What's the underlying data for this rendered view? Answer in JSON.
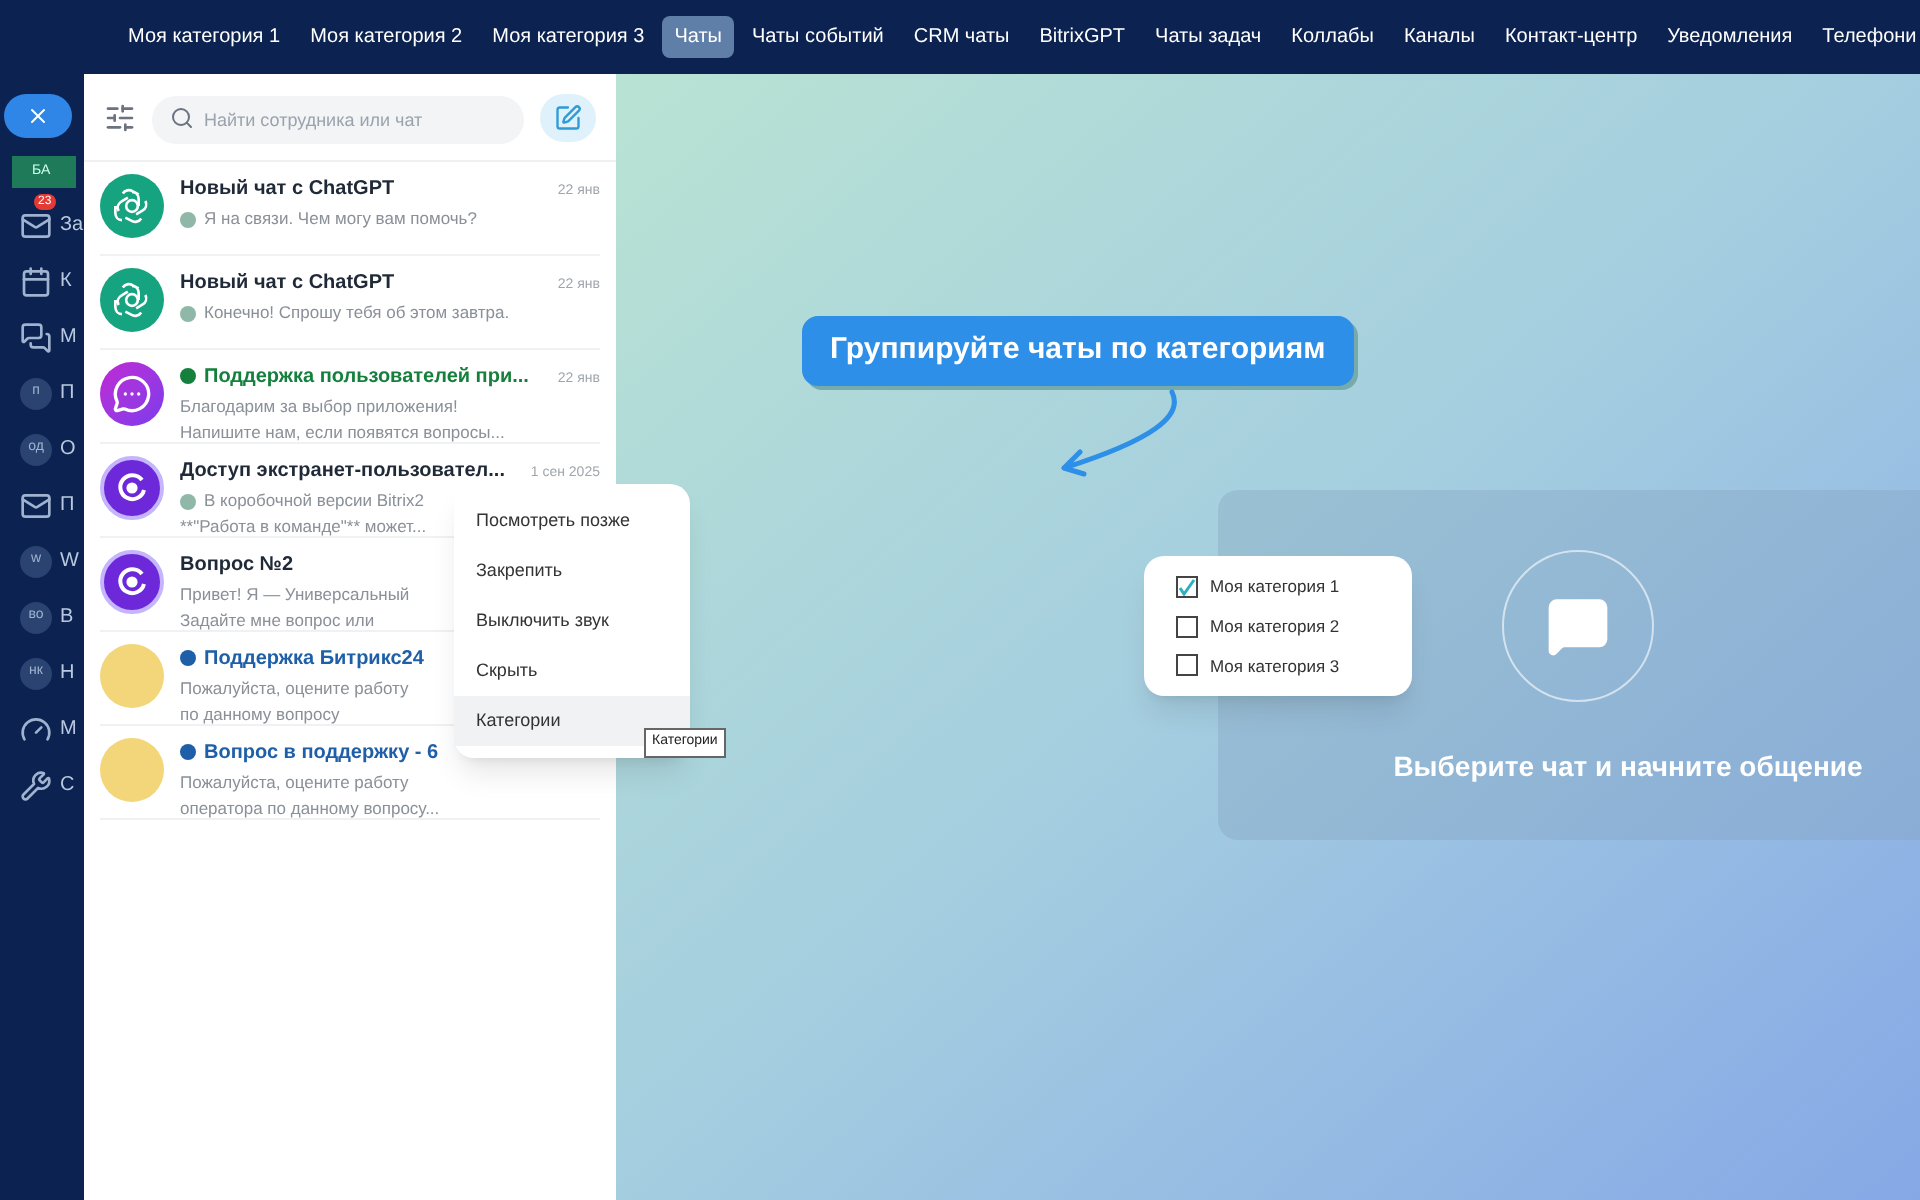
{
  "top_nav": [
    {
      "label": "Моя категория 1",
      "selected": false
    },
    {
      "label": "Моя категория 2",
      "selected": false
    },
    {
      "label": "Моя категория 3",
      "selected": false
    },
    {
      "label": "Чаты",
      "selected": true
    },
    {
      "label": "Чаты событий",
      "selected": false
    },
    {
      "label": "CRM чаты",
      "selected": false
    },
    {
      "label": "BitrixGPT",
      "selected": false
    },
    {
      "label": "Чаты задач",
      "selected": false
    },
    {
      "label": "Коллабы",
      "selected": false
    },
    {
      "label": "Каналы",
      "selected": false
    },
    {
      "label": "Контакт-центр",
      "selected": false
    },
    {
      "label": "Уведомления",
      "selected": false
    },
    {
      "label": "Телефони"
    }
  ],
  "sidebar": {
    "button_label": "БА",
    "items": [
      {
        "kind": "mail",
        "label": "За",
        "badge": "23"
      },
      {
        "kind": "calendar",
        "label": "К"
      },
      {
        "kind": "chat",
        "label": "М"
      },
      {
        "kind": "initials",
        "initials": "п",
        "label": "П"
      },
      {
        "kind": "initials",
        "initials": "од",
        "label": "О"
      },
      {
        "kind": "mail",
        "label": "П"
      },
      {
        "kind": "initials",
        "initials": "w",
        "label": "W"
      },
      {
        "kind": "initials",
        "initials": "во",
        "label": "В"
      },
      {
        "kind": "initials",
        "initials": "нк",
        "label": "Н"
      },
      {
        "kind": "gauge",
        "label": "М"
      },
      {
        "kind": "wrench",
        "label": "С"
      }
    ]
  },
  "chat_panel": {
    "search": {
      "placeholder": "Найти сотрудника или чат"
    },
    "chats": [
      {
        "avatar": {
          "kind": "chatgpt"
        },
        "title": "Новый чат с ChatGPT",
        "color": "#1f2937",
        "date": "22 янв",
        "status": {
          "kind": "dot"
        },
        "preview": [
          "Я на связи. Чем могу вам помочь?"
        ]
      },
      {
        "avatar": {
          "kind": "chatgpt"
        },
        "title": "Новый чат с ChatGPT",
        "color": "#1f2937",
        "date": "22 янв",
        "status": {
          "kind": "dot"
        },
        "preview": [
          "Конечно! Спрошу тебя об этом завтра."
        ]
      },
      {
        "avatar": {
          "kind": "support"
        },
        "title": "Поддержка пользователей при...",
        "color": "#15803d",
        "date": "22 янв",
        "status": {
          "kind": "title"
        },
        "preview": [
          "Благодарим за выбор приложения!",
          "Напишите нам, если появятся вопросы..."
        ]
      },
      {
        "avatar": {
          "kind": "bitrix"
        },
        "title": "Доступ экстранет-пользовател...",
        "color": "#1f2937",
        "date": "1 сен 2025",
        "status": {
          "kind": "dot"
        },
        "preview": [
          "В коробочной версии Bitrix2",
          "**\"Работа в команде\"** может..."
        ]
      },
      {
        "avatar": {
          "kind": "bitrix"
        },
        "title": "Вопрос №2",
        "color": "#1f2937",
        "preview": [
          "Привет! Я — Универсальный",
          "Задайте мне вопрос или"
        ]
      },
      {
        "avatar": {
          "kind": "group"
        },
        "title": "Поддержка Битрикс24",
        "color": "#1e5fa8",
        "status": {
          "kind": "title"
        },
        "preview": [
          "Пожалуйста, оцените работу",
          "по данному вопросу"
        ]
      },
      {
        "avatar": {
          "kind": "group"
        },
        "title": "Вопрос в поддержку - 6",
        "color": "#1e5fa8",
        "status": {
          "kind": "title"
        },
        "preview": [
          "Пожалуйста, оцените работу",
          "оператора по данному вопросу..."
        ]
      }
    ]
  },
  "context_menu": {
    "items": [
      {
        "label": "Посмотреть позже",
        "selected": false
      },
      {
        "label": "Закрепить",
        "selected": false
      },
      {
        "label": "Выключить звук",
        "selected": false
      },
      {
        "label": "Скрыть",
        "selected": false
      },
      {
        "label": "Категории",
        "selected": true
      }
    ],
    "tooltip": "Категории"
  },
  "callout": "Группируйте чаты по категориям",
  "categories": [
    {
      "label": "Моя категория 1",
      "checked": true
    },
    {
      "label": "Моя категория 2",
      "checked": false
    },
    {
      "label": "Моя категория 3",
      "checked": false
    }
  ],
  "empty_state": {
    "text": "Выберите чат и начните общение"
  }
}
